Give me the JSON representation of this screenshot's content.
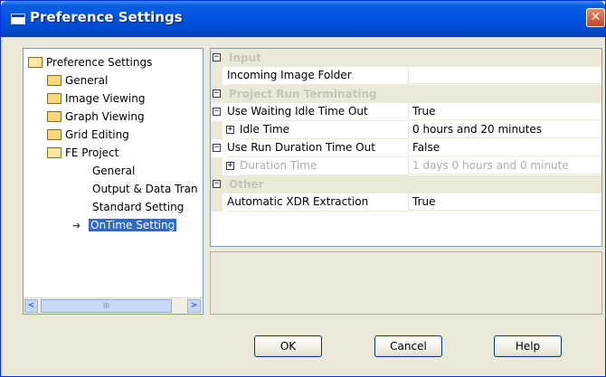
{
  "window": {
    "title": "Preference Settings",
    "close_glyph": "✕"
  },
  "tree": {
    "root": "Preference Settings",
    "items": [
      {
        "label": "General"
      },
      {
        "label": "Image Viewing"
      },
      {
        "label": "Graph Viewing"
      },
      {
        "label": "Grid Editing"
      },
      {
        "label": "FE Project"
      }
    ],
    "fe_children": [
      {
        "label": "General"
      },
      {
        "label": "Output & Data Tran"
      },
      {
        "label": "Standard Setting"
      },
      {
        "label": "OnTime Setting",
        "selected": true
      }
    ],
    "scroll": {
      "left": "<",
      "right": ">",
      "thumb_grip": "III"
    }
  },
  "grid": {
    "expanded_glyph": "−",
    "collapsed_glyph": "+",
    "categories": [
      {
        "label": "Input"
      },
      {
        "label": "Project Run Terminating"
      },
      {
        "label": "Other"
      }
    ],
    "rows": [
      {
        "name": "Incoming Image Folder",
        "value": ""
      },
      {
        "name": "Use Waiting Idle Time Out",
        "value": "True"
      },
      {
        "name": "Idle Time",
        "value": "0 hours and 20 minutes"
      },
      {
        "name": "Use Run Duration Time Out",
        "value": "False"
      },
      {
        "name": "Duration Time",
        "value": "1 days 0 hours and 0 minute"
      },
      {
        "name": "Automatic XDR Extraction",
        "value": "True"
      }
    ]
  },
  "buttons": {
    "ok": "OK",
    "cancel": "Cancel",
    "help": "Help"
  },
  "colors": {
    "titlebar": "#0054e3",
    "selection": "#316ac5",
    "category_text": "#c8c4b8"
  }
}
